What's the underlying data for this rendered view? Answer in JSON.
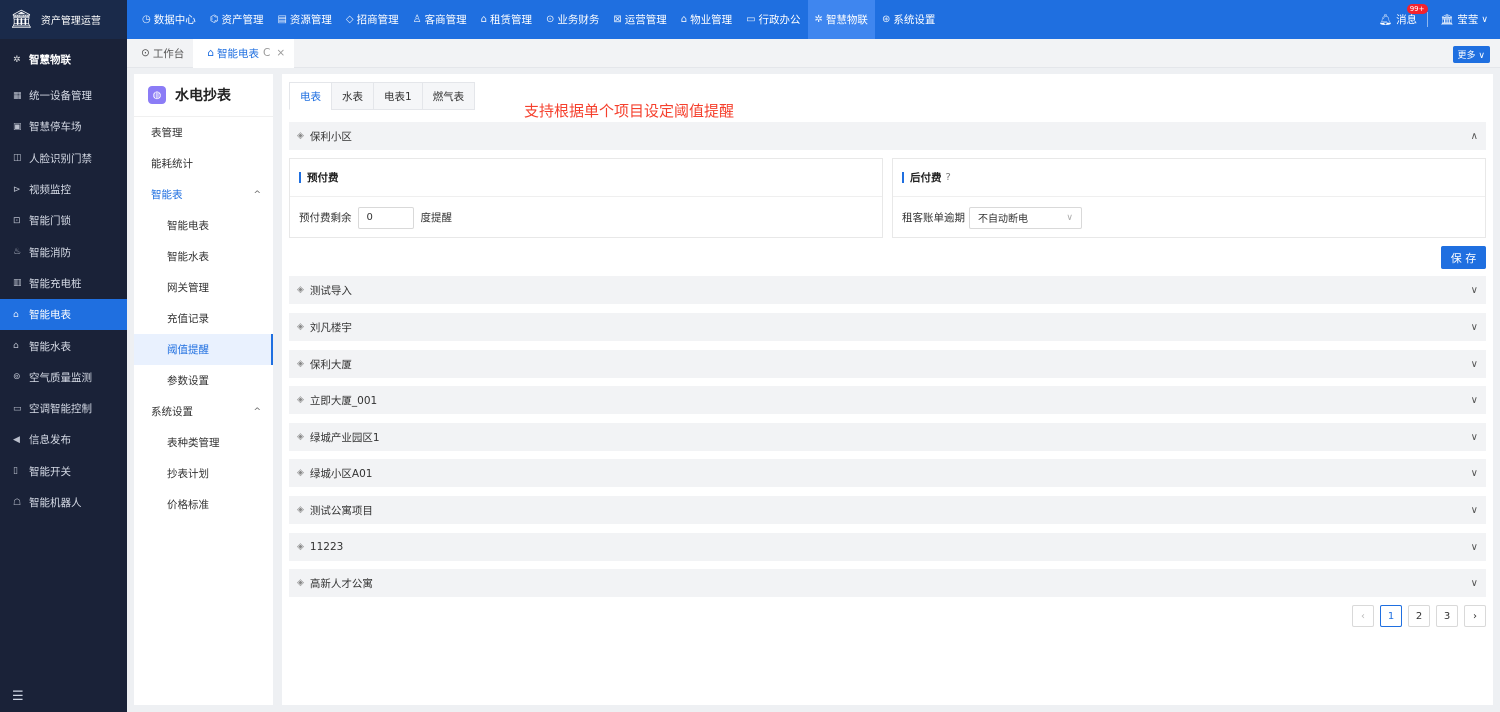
{
  "app": {
    "logo_text": "资产管理运营"
  },
  "topnav": [
    {
      "icon": "◷",
      "label": "数据中心"
    },
    {
      "icon": "⌬",
      "label": "资产管理"
    },
    {
      "icon": "▤",
      "label": "资源管理"
    },
    {
      "icon": "◇",
      "label": "招商管理"
    },
    {
      "icon": "♙",
      "label": "客商管理"
    },
    {
      "icon": "⌂",
      "label": "租赁管理"
    },
    {
      "icon": "⊙",
      "label": "业务财务"
    },
    {
      "icon": "⊠",
      "label": "运营管理"
    },
    {
      "icon": "⌂",
      "label": "物业管理"
    },
    {
      "icon": "▭",
      "label": "行政办公"
    },
    {
      "icon": "✲",
      "label": "智慧物联"
    },
    {
      "icon": "⊛",
      "label": "系统设置"
    }
  ],
  "topright": {
    "msg_label": "消息",
    "msg_badge": "99+",
    "user_name": "莹莹"
  },
  "sidebar": {
    "head": "智慧物联",
    "items": [
      {
        "icon": "▦",
        "label": "统一设备管理"
      },
      {
        "icon": "▣",
        "label": "智慧停车场"
      },
      {
        "icon": "◫",
        "label": "人脸识别门禁"
      },
      {
        "icon": "⊳",
        "label": "视频监控"
      },
      {
        "icon": "⊡",
        "label": "智能门锁"
      },
      {
        "icon": "♨",
        "label": "智能消防"
      },
      {
        "icon": "▥",
        "label": "智能充电桩"
      },
      {
        "icon": "⌂",
        "label": "智能电表"
      },
      {
        "icon": "⌂",
        "label": "智能水表"
      },
      {
        "icon": "⊚",
        "label": "空气质量监测"
      },
      {
        "icon": "▭",
        "label": "空调智能控制"
      },
      {
        "icon": "◀",
        "label": "信息发布"
      },
      {
        "icon": "▯",
        "label": "智能开关"
      },
      {
        "icon": "☖",
        "label": "智能机器人"
      }
    ]
  },
  "tabs": [
    {
      "icon": "⊙",
      "label": "工作台"
    },
    {
      "icon": "⌂",
      "label": "智能电表",
      "refresh": "C",
      "close": "×"
    }
  ],
  "more_label": "更多 ∨",
  "subside": {
    "title": "水电抄表",
    "items": [
      {
        "label": "表管理"
      },
      {
        "label": "能耗统计"
      },
      {
        "label": "智能表",
        "caret": "^"
      },
      {
        "label": "智能电表"
      },
      {
        "label": "智能水表"
      },
      {
        "label": "网关管理"
      },
      {
        "label": "充值记录"
      },
      {
        "label": "阈值提醒"
      },
      {
        "label": "参数设置"
      },
      {
        "label": "系统设置",
        "caret": "^"
      },
      {
        "label": "表种类管理"
      },
      {
        "label": "抄表计划"
      },
      {
        "label": "价格标准"
      }
    ]
  },
  "main": {
    "meter_tabs": [
      "电表",
      "水表",
      "电表1",
      "燃气表"
    ],
    "annotation": "支持根据单个项目设定阈值提醒",
    "expanded_project": "保利小区",
    "prepaid": {
      "title": "预付费",
      "label_before": "预付费剩余",
      "value": "0",
      "label_after": "度提醒"
    },
    "postpaid": {
      "title": "后付费",
      "help": "?",
      "label": "租客账单逾期",
      "select_value": "不自动断电"
    },
    "save_label": "保 存",
    "projects": [
      "测试导入",
      "刘凡楼宇",
      "保利大厦",
      "立即大厦_001",
      "绿城产业园区1",
      "绿城小区A01",
      "测试公寓项目",
      "11223",
      "高新人才公寓"
    ]
  },
  "pagination": {
    "pages": [
      "1",
      "2",
      "3"
    ],
    "current": "1"
  }
}
